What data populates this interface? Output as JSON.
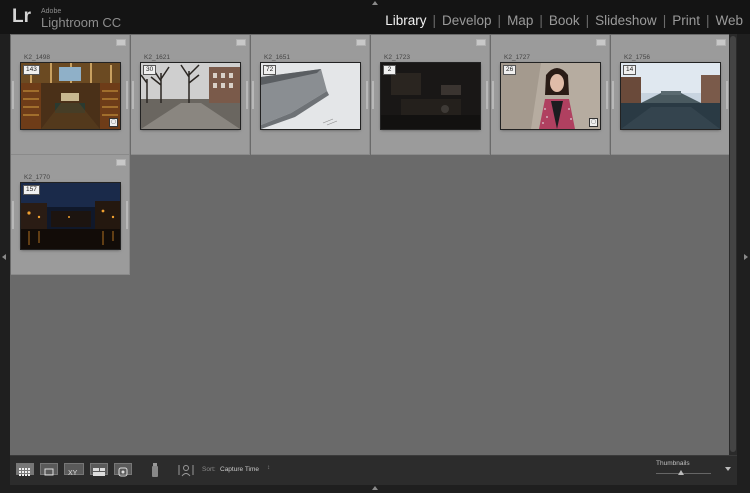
{
  "header": {
    "logo_mark": "Lr",
    "logo_small": "Adobe",
    "logo_large": "Lightroom CC",
    "modules": [
      {
        "label": "Library",
        "active": true
      },
      {
        "label": "Develop",
        "active": false
      },
      {
        "label": "Map",
        "active": false
      },
      {
        "label": "Book",
        "active": false
      },
      {
        "label": "Slideshow",
        "active": false
      },
      {
        "label": "Print",
        "active": false
      },
      {
        "label": "Web",
        "active": false
      }
    ],
    "separator": "|"
  },
  "grid": {
    "photos": [
      {
        "name": "K2_1498",
        "count": "143",
        "scene": "library-interior",
        "edited": true
      },
      {
        "name": "K2_1621",
        "count": "30",
        "scene": "street-trees",
        "edited": false
      },
      {
        "name": "K2_1651",
        "count": "72",
        "scene": "building-angle",
        "edited": false
      },
      {
        "name": "K2_1723",
        "count": "2",
        "scene": "dark-room",
        "edited": false
      },
      {
        "name": "K2_1727",
        "count": "26",
        "scene": "portrait",
        "edited": true
      },
      {
        "name": "K2_1756",
        "count": "14",
        "scene": "canal-day",
        "edited": false
      },
      {
        "name": "K2_1770",
        "count": "157",
        "scene": "canal-night",
        "edited": false
      }
    ]
  },
  "toolbar": {
    "sort_label": "Sort:",
    "sort_value": "Capture Time",
    "sort_arrows": "↕",
    "thumbnails_label": "Thumbnails",
    "thumbnail_size": 0.45,
    "view_modes": [
      "grid-view-icon",
      "loupe-view-icon",
      "compare-view-icon",
      "survey-view-icon",
      "people-view-icon"
    ],
    "painter_icon": "spray-painter-icon",
    "people_icon": "people-face-icon"
  },
  "colors": {
    "active_module": "#f2f2f2",
    "inactive_module": "#9a9a9a",
    "grid_bg": "#6a6a6a",
    "cell_bg": "#9b9b9b"
  }
}
